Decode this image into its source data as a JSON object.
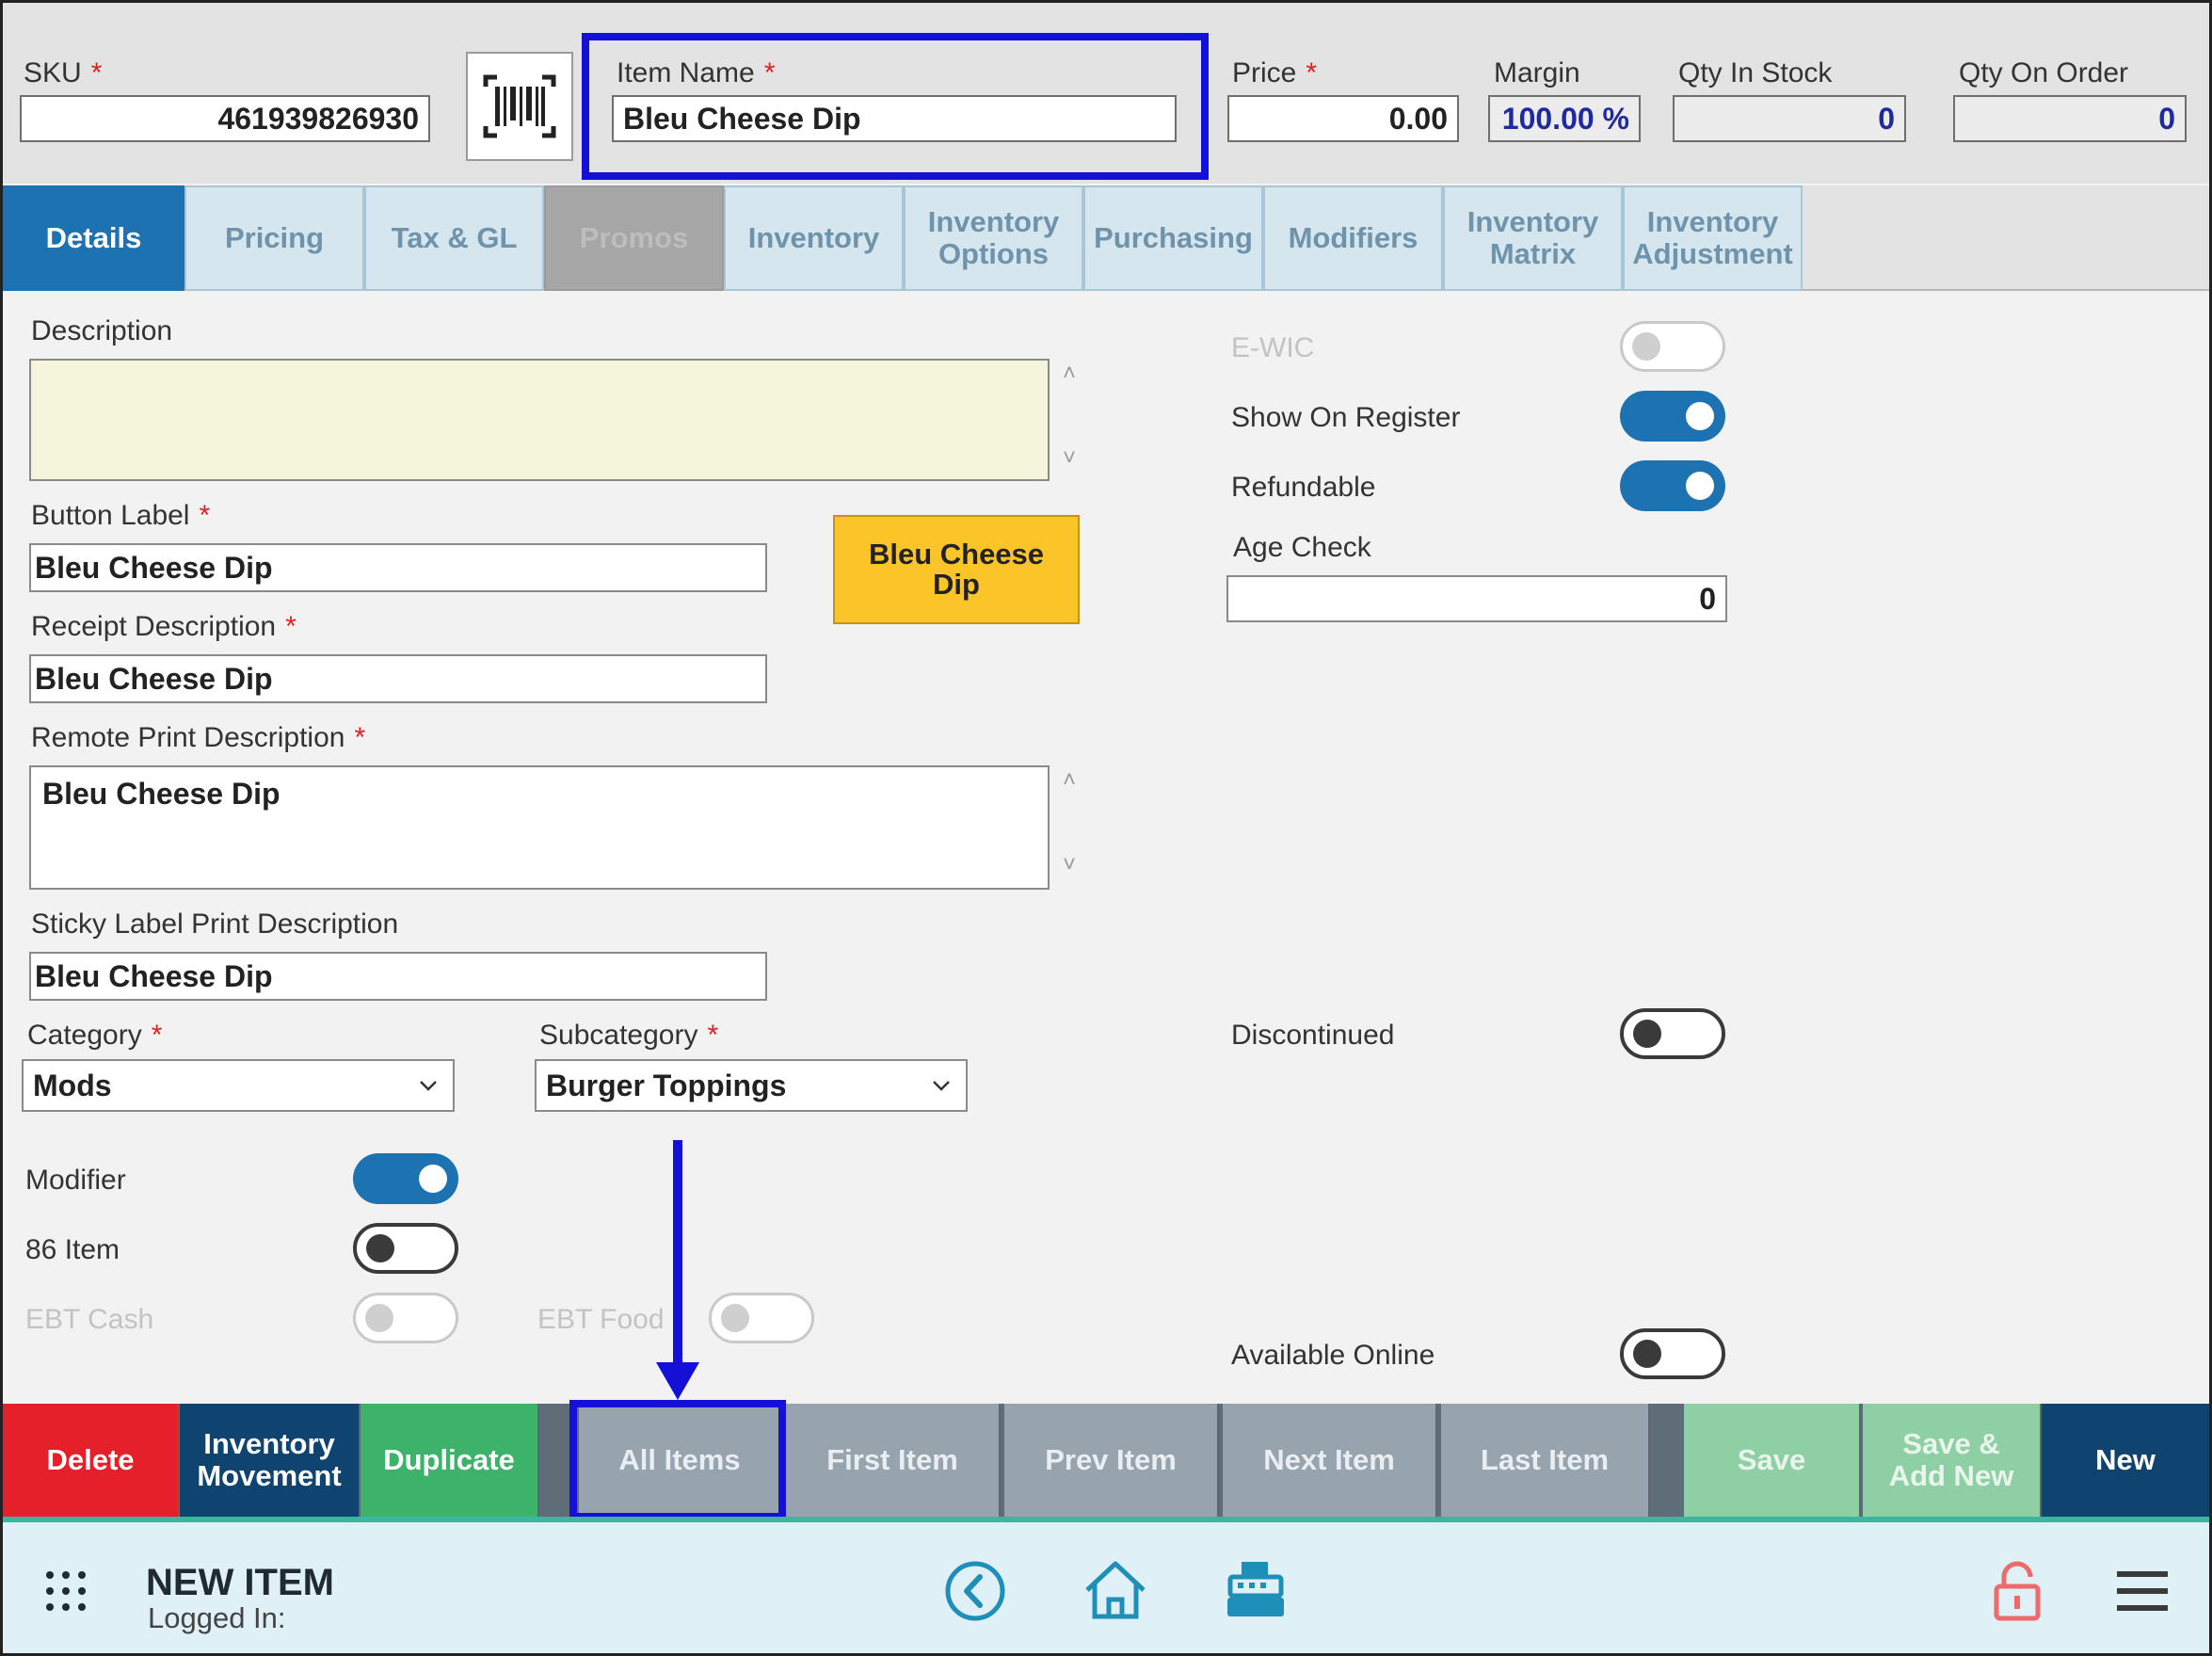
{
  "header": {
    "sku_label": "SKU",
    "sku_value": "461939826930",
    "item_name_label": "Item Name",
    "item_name_value": "Bleu Cheese Dip",
    "price_label": "Price",
    "price_value": "0.00",
    "margin_label": "Margin",
    "margin_value": "100.00 %",
    "qty_in_stock_label": "Qty In Stock",
    "qty_in_stock_value": "0",
    "qty_on_order_label": "Qty On Order",
    "qty_on_order_value": "0",
    "required_mark": "*"
  },
  "tabs": [
    {
      "line1": "Details",
      "line2": "",
      "state": "active"
    },
    {
      "line1": "Pricing",
      "line2": "",
      "state": "normal"
    },
    {
      "line1": "Tax & GL",
      "line2": "",
      "state": "normal"
    },
    {
      "line1": "Promos",
      "line2": "",
      "state": "disabled"
    },
    {
      "line1": "Inventory",
      "line2": "",
      "state": "normal"
    },
    {
      "line1": "Inventory",
      "line2": "Options",
      "state": "normal"
    },
    {
      "line1": "Purchasing",
      "line2": "",
      "state": "normal"
    },
    {
      "line1": "Modifiers",
      "line2": "",
      "state": "normal"
    },
    {
      "line1": "Inventory",
      "line2": "Matrix",
      "state": "normal"
    },
    {
      "line1": "Inventory",
      "line2": "Adjustment",
      "state": "normal"
    }
  ],
  "form": {
    "description_label": "Description",
    "description_value": "",
    "button_label_label": "Button Label",
    "button_label_value": "Bleu Cheese Dip",
    "button_preview_line1": "Bleu Cheese",
    "button_preview_line2": "Dip",
    "receipt_description_label": "Receipt Description",
    "receipt_description_value": "Bleu Cheese Dip",
    "remote_print_label": "Remote Print Description",
    "remote_print_value": "Bleu Cheese Dip",
    "sticky_label_label": "Sticky Label Print Description",
    "sticky_label_value": "Bleu Cheese Dip",
    "category_label": "Category",
    "category_value": "Mods",
    "subcategory_label": "Subcategory",
    "subcategory_value": "Burger Toppings",
    "modifier_label": "Modifier",
    "modifier_on": true,
    "item86_label": "86 Item",
    "item86_on": false,
    "ebt_cash_label": "EBT Cash",
    "ebt_food_label": "EBT Food"
  },
  "right": {
    "ewic_label": "E-WIC",
    "show_on_register_label": "Show On Register",
    "show_on_register_on": true,
    "refundable_label": "Refundable",
    "refundable_on": true,
    "age_check_label": "Age Check",
    "age_check_value": "0",
    "discontinued_label": "Discontinued",
    "discontinued_on": false,
    "available_online_label": "Available Online",
    "available_online_on": false
  },
  "buttons": {
    "delete": "Delete",
    "inventory_movement_1": "Inventory",
    "inventory_movement_2": "Movement",
    "duplicate": "Duplicate",
    "all_items": "All Items",
    "first_item": "First Item",
    "prev_item": "Prev Item",
    "next_item": "Next Item",
    "last_item": "Last Item",
    "save": "Save",
    "save_add_new_1": "Save &",
    "save_add_new_2": "Add New",
    "new": "New"
  },
  "footer": {
    "title": "NEW ITEM",
    "logged_in": "Logged In:"
  },
  "icons": [
    "barcode-icon",
    "apps-grid-icon",
    "back-circle-icon",
    "home-icon",
    "register-icon",
    "lock-icon",
    "menu-icon"
  ],
  "colors": {
    "active_tab": "#1d73b2",
    "delete": "#e5202a",
    "navy": "#0f4470",
    "duplicate": "#3db26a",
    "preview_button": "#fbc52a",
    "highlight": "#1410d8"
  }
}
